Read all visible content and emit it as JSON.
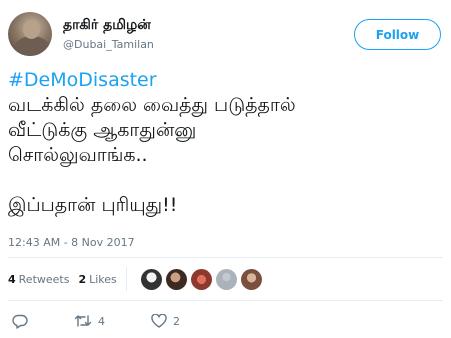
{
  "user": {
    "display_name": "தாகிர் தமிழன்",
    "handle": "@Dubai_Tamilan"
  },
  "follow_button": {
    "label": "Follow"
  },
  "tweet": {
    "hashtag": "#DeMoDisaster",
    "lines": [
      "வடக்கில் தலை வைத்து படுத்தால்",
      "வீட்டுக்கு ஆகாதுன்னு",
      "சொல்லுவாங்க.."
    ],
    "last_line": "இப்பதான் புரியுது!!",
    "timestamp": "12:43 AM - 8 Nov 2017"
  },
  "stats": {
    "retweets": {
      "count": "4",
      "label": "Retweets"
    },
    "likes": {
      "count": "2",
      "label": "Likes"
    }
  },
  "actions": {
    "reply": {
      "icon": "reply-icon"
    },
    "retweet": {
      "icon": "retweet-icon",
      "count": "4"
    },
    "like": {
      "icon": "heart-icon",
      "count": "2"
    }
  },
  "colors": {
    "accent": "#1da1f2",
    "muted": "#657786",
    "text": "#14171a",
    "border": "#e6ecf0"
  }
}
